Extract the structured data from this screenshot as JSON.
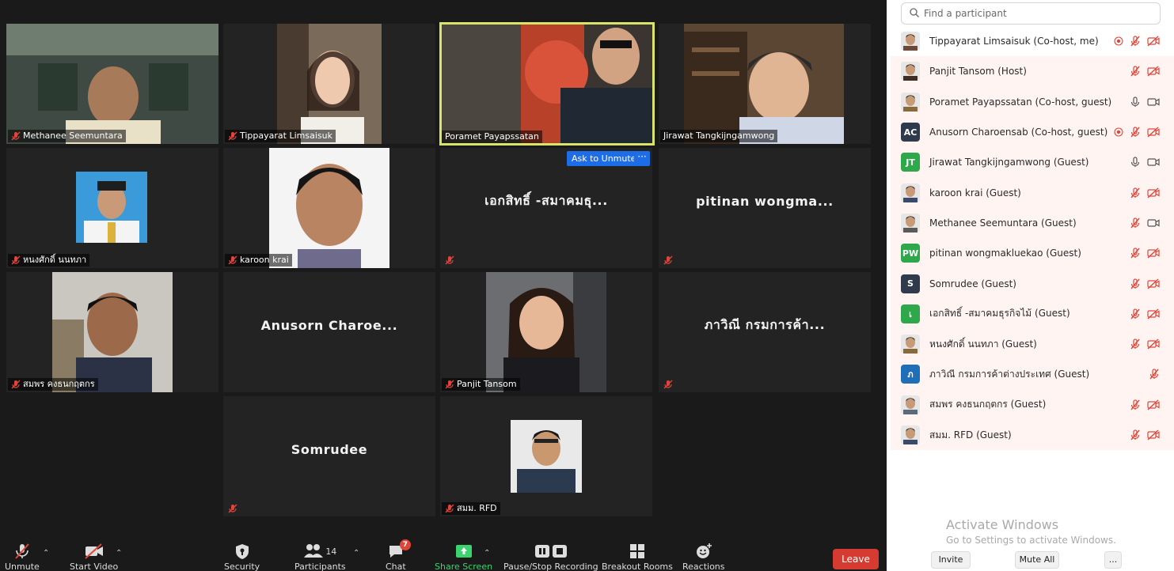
{
  "video_tiles": [
    {
      "name": "Methanee Seemuntara"
    },
    {
      "name": "Tippayarat Limsaisuk"
    },
    {
      "name": "Poramet Payapssatan"
    },
    {
      "name": "Jirawat Tangkijngamwong"
    },
    {
      "name": "หนงศักดิ์ นนทภา"
    },
    {
      "name": "karoon krai"
    },
    {
      "big_name": "เอกสิทธิ์ -สมาคมธุ..."
    },
    {
      "big_name": "pitinan wongma..."
    },
    {
      "name": "สมพร คงธนกฤตกร"
    },
    {
      "big_name": "Anusorn Charoe..."
    },
    {
      "name": "Panjit Tansom"
    },
    {
      "big_name": "ภาวิณี กรมการค้า..."
    },
    {
      "big_name": "Somrudee"
    },
    {
      "name": "สมม. RFD"
    }
  ],
  "ask_to_unmute": "Ask to Unmute",
  "ask_more": "···",
  "toolbar": {
    "unmute": "Unmute",
    "start_video": "Start Video",
    "security": "Security",
    "participants": "Participants",
    "participants_count": "14",
    "chat": "Chat",
    "chat_badge": "7",
    "share_screen": "Share Screen",
    "pause_stop_recording": "Pause/Stop Recording",
    "breakout_rooms": "Breakout Rooms",
    "reactions": "Reactions",
    "leave": "Leave"
  },
  "panel": {
    "search_placeholder": "Find a participant",
    "participants": [
      {
        "name": "Tippayarat Limsaisuk (Co-host, me)",
        "avatar": "photo",
        "rec": true,
        "mic": "muted",
        "video": "off"
      },
      {
        "name": "Panjit Tansom (Host)",
        "avatar": "photo",
        "mic": "muted",
        "video": "off"
      },
      {
        "name": "Poramet Payapssatan (Co-host, guest)",
        "avatar": "photo",
        "mic": "on",
        "video": "on"
      },
      {
        "name": "Anusorn Charoensab (Co-host, guest)",
        "avatar": "AC",
        "color": "#2f3b4c",
        "rec": true,
        "mic": "muted",
        "video": "off"
      },
      {
        "name": "Jirawat Tangkijngamwong (Guest)",
        "avatar": "JT",
        "color": "#2ea84a",
        "mic": "on",
        "video": "on"
      },
      {
        "name": "karoon krai (Guest)",
        "avatar": "photo",
        "mic": "muted",
        "video": "off"
      },
      {
        "name": "Methanee Seemuntara (Guest)",
        "avatar": "photo",
        "mic": "muted",
        "video": "on"
      },
      {
        "name": "pitinan wongmakluekao (Guest)",
        "avatar": "PW",
        "color": "#2ea84a",
        "mic": "muted",
        "video": "off"
      },
      {
        "name": "Somrudee (Guest)",
        "avatar": "S",
        "color": "#2f3b4c",
        "mic": "muted",
        "video": "off"
      },
      {
        "name": "เอกสิทธิ์ -สมาคมธุรกิจไม้ (Guest)",
        "avatar": "เ",
        "color": "#2ea84a",
        "mic": "muted",
        "video": "off"
      },
      {
        "name": "หนงศักดิ์ นนทภา (Guest)",
        "avatar": "photo",
        "mic": "muted",
        "video": "off"
      },
      {
        "name": "ภาวิณี กรมการค้าต่างประเทศ (Guest)",
        "avatar": "ภ",
        "color": "#1f6fb8",
        "mic": "muted"
      },
      {
        "name": "สมพร คงธนกฤตกร (Guest)",
        "avatar": "photo",
        "mic": "muted",
        "video": "off"
      },
      {
        "name": "สมม. RFD (Guest)",
        "avatar": "photo",
        "mic": "muted",
        "video": "off"
      }
    ],
    "watermark_title": "Activate Windows",
    "watermark_sub": "Go to Settings to activate Windows.",
    "invite": "Invite",
    "mute_all": "Mute All",
    "more": "..."
  },
  "colors": {
    "video_bg": "#1a1a1a",
    "tile_bg": "#232323",
    "active_speaker": "#d7e66a",
    "mute_red": "#e0453a",
    "unmute_blue": "#1d6ee6",
    "share_green": "#3ad36e",
    "leave_red": "#d63b32"
  }
}
